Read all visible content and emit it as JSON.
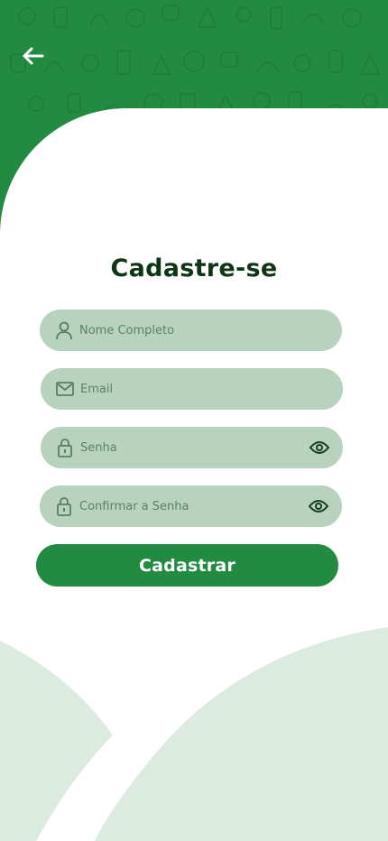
{
  "colors": {
    "brand": "#228B41",
    "field_bg": "#B7D3BE",
    "title": "#0E3616",
    "decor": "#DCEBE0"
  },
  "header": {
    "back_icon": "arrow-left-icon"
  },
  "form": {
    "title": "Cadastre-se",
    "fields": {
      "name": {
        "placeholder": "Nome Completo",
        "icon": "user-icon"
      },
      "email": {
        "placeholder": "Email",
        "icon": "mail-icon"
      },
      "password": {
        "placeholder": "Senha",
        "icon": "lock-icon",
        "toggle_icon": "eye-icon"
      },
      "confirm": {
        "placeholder": "Confirmar a Senha",
        "icon": "lock-icon",
        "toggle_icon": "eye-icon"
      }
    },
    "submit_label": "Cadastrar"
  }
}
